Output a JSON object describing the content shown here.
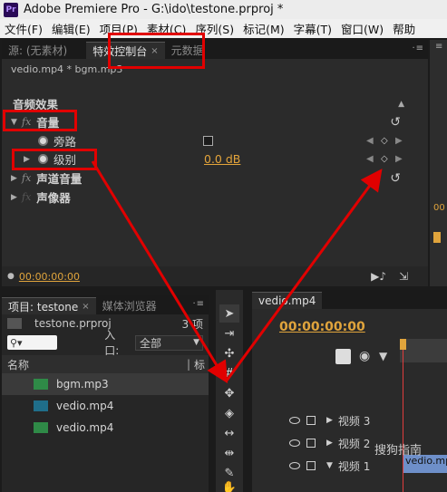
{
  "window": {
    "title": "Adobe Premiere Pro - G:\\ido\\testone.prproj *",
    "logo": "Pr"
  },
  "menu": [
    "文件(F)",
    "编辑(E)",
    "项目(P)",
    "素材(C)",
    "序列(S)",
    "标记(M)",
    "字幕(T)",
    "窗口(W)",
    "帮助"
  ],
  "top_tabs": {
    "source": "源: (无素材)",
    "effect_controls": "特效控制台",
    "metadata": "元数据"
  },
  "effects": {
    "clip_path": "vedio.mp4 * bgm.mp3",
    "section": "音频效果",
    "volume": "音量",
    "bypass": "旁路",
    "level": "级别",
    "level_value": "0.0 dB",
    "channel_volume": "声道音量",
    "panner": "声像器",
    "timecode": "00:00:00:00"
  },
  "project": {
    "tab_project": "项目: testone",
    "tab_media": "媒体浏览器",
    "file": "testone.prproj",
    "count": "3 项",
    "entry_label": "入口:",
    "entry_value": "全部",
    "col_name": "名称",
    "col_label": "标",
    "assets": [
      {
        "name": "bgm.mp3",
        "type": "audio-icon"
      },
      {
        "name": "vedio.mp4",
        "type": "sequence-icon"
      },
      {
        "name": "vedio.mp4",
        "type": "sequence-icon"
      }
    ]
  },
  "timeline": {
    "tab": "vedio.mp4",
    "timecode": "00:00:00:00",
    "tracks": [
      "视频 3",
      "视频 2",
      "视频 1"
    ],
    "clip_label": "vedio.mp4"
  },
  "watermark": "搜狗指南",
  "colors": {
    "accent_timecode": "#e0a43c",
    "annotation_red": "#e10000",
    "panel_bg": "#2b2b2b"
  }
}
